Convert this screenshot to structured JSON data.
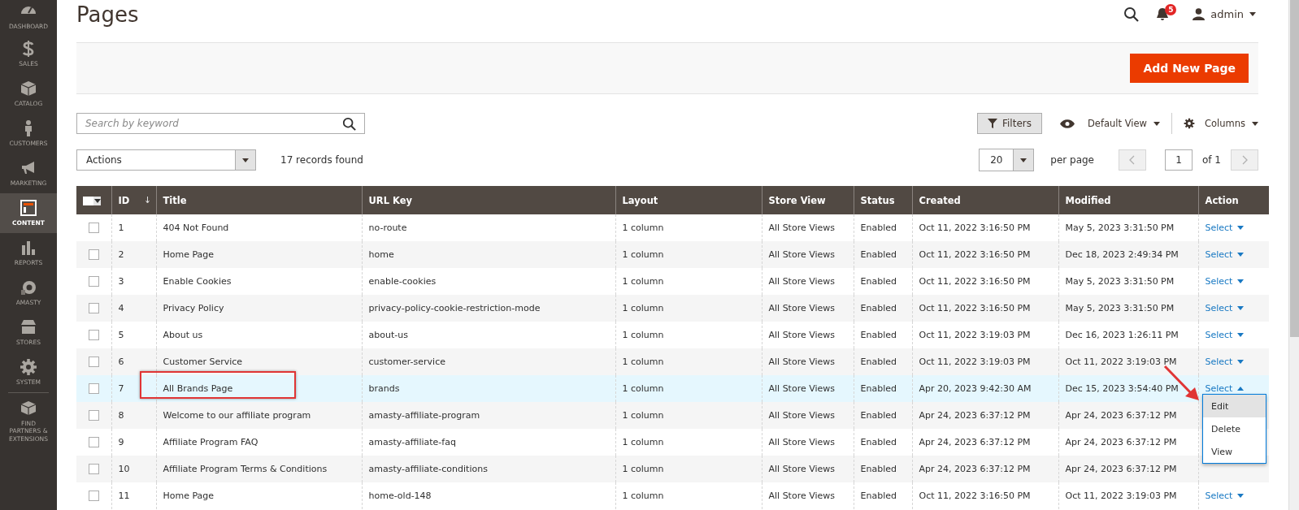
{
  "sidebar": {
    "items": [
      {
        "label": "DASHBOARD",
        "selected": false
      },
      {
        "label": "SALES",
        "selected": false
      },
      {
        "label": "CATALOG",
        "selected": false
      },
      {
        "label": "CUSTOMERS",
        "selected": false
      },
      {
        "label": "MARKETING",
        "selected": false
      },
      {
        "label": "CONTENT",
        "selected": true
      },
      {
        "label": "REPORTS",
        "selected": false
      },
      {
        "label": "AMASTY",
        "selected": false
      },
      {
        "label": "STORES",
        "selected": false
      },
      {
        "label": "SYSTEM",
        "selected": false
      },
      {
        "label": "FIND PARTNERS & EXTENSIONS",
        "selected": false
      }
    ]
  },
  "header": {
    "title": "Pages",
    "notifications": "5",
    "user": "admin"
  },
  "page_actions": {
    "button": "Add New Page"
  },
  "toolbar": {
    "search": {
      "placeholder": "Search by keyword"
    },
    "filters": "Filters",
    "view": "Default View",
    "columns": "Columns",
    "actions": "Actions",
    "records": "17 records found",
    "per_page_value": "20",
    "per_page": "per page",
    "page": "1",
    "of_pages": "of 1"
  },
  "table": {
    "select_all_checked": false,
    "columns": [
      "ID",
      "Title",
      "URL Key",
      "Layout",
      "Store View",
      "Status",
      "Created",
      "Modified",
      "Action"
    ],
    "rows": [
      {
        "id": "1",
        "title": "404 Not Found",
        "url_key": "no-route",
        "layout": "1 column",
        "store_view": "All Store Views",
        "status": "Enabled",
        "created": "Oct 11, 2022 3:16:50 PM",
        "modified": "May 5, 2023 3:31:50 PM",
        "action": "Select",
        "checked": false,
        "selected": false,
        "expanded": false
      },
      {
        "id": "2",
        "title": "Home Page",
        "url_key": "home",
        "layout": "1 column",
        "store_view": "All Store Views",
        "status": "Enabled",
        "created": "Oct 11, 2022 3:16:50 PM",
        "modified": "Dec 18, 2023 2:49:34 PM",
        "action": "Select",
        "checked": false,
        "selected": false,
        "expanded": false
      },
      {
        "id": "3",
        "title": "Enable Cookies",
        "url_key": "enable-cookies",
        "layout": "1 column",
        "store_view": "All Store Views",
        "status": "Enabled",
        "created": "Oct 11, 2022 3:16:50 PM",
        "modified": "May 5, 2023 3:31:50 PM",
        "action": "Select",
        "checked": false,
        "selected": false,
        "expanded": false
      },
      {
        "id": "4",
        "title": "Privacy Policy",
        "url_key": "privacy-policy-cookie-restriction-mode",
        "layout": "1 column",
        "store_view": "All Store Views",
        "status": "Enabled",
        "created": "Oct 11, 2022 3:16:50 PM",
        "modified": "May 5, 2023 3:31:50 PM",
        "action": "Select",
        "checked": false,
        "selected": false,
        "expanded": false
      },
      {
        "id": "5",
        "title": "About us",
        "url_key": "about-us",
        "layout": "1 column",
        "store_view": "All Store Views",
        "status": "Enabled",
        "created": "Oct 11, 2022 3:19:03 PM",
        "modified": "Dec 16, 2023 1:26:11 PM",
        "action": "Select",
        "checked": false,
        "selected": false,
        "expanded": false
      },
      {
        "id": "6",
        "title": "Customer Service",
        "url_key": "customer-service",
        "layout": "1 column",
        "store_view": "All Store Views",
        "status": "Enabled",
        "created": "Oct 11, 2022 3:19:03 PM",
        "modified": "Oct 11, 2022 3:19:03 PM",
        "action": "Select",
        "checked": false,
        "selected": false,
        "expanded": false
      },
      {
        "id": "7",
        "title": "All Brands Page",
        "url_key": "brands",
        "layout": "1 column",
        "store_view": "All Store Views",
        "status": "Enabled",
        "created": "Apr 20, 2023 9:42:30 AM",
        "modified": "Dec 15, 2023 3:54:40 PM",
        "action": "Select",
        "checked": false,
        "selected": true,
        "expanded": true,
        "menu": [
          {
            "label": "Edit",
            "selected": true
          },
          {
            "label": "Delete",
            "selected": false
          },
          {
            "label": "View",
            "selected": false
          }
        ]
      },
      {
        "id": "8",
        "title": "Welcome to our affiliate program",
        "url_key": "amasty-affiliate-program",
        "layout": "1 column",
        "store_view": "All Store Views",
        "status": "Enabled",
        "created": "Apr 24, 2023 6:37:12 PM",
        "modified": "Apr 24, 2023 6:37:12 PM",
        "checked": false,
        "selected": false
      },
      {
        "id": "9",
        "title": "Affiliate Program FAQ",
        "url_key": "amasty-affiliate-faq",
        "layout": "1 column",
        "store_view": "All Store Views",
        "status": "Enabled",
        "created": "Apr 24, 2023 6:37:12 PM",
        "modified": "Apr 24, 2023 6:37:12 PM",
        "checked": false,
        "selected": false
      },
      {
        "id": "10",
        "title": "Affiliate Program Terms & Conditions",
        "url_key": "amasty-affiliate-conditions",
        "layout": "1 column",
        "store_view": "All Store Views",
        "status": "Enabled",
        "created": "Apr 24, 2023 6:37:12 PM",
        "modified": "Apr 24, 2023 6:37:12 PM",
        "checked": false,
        "selected": false
      },
      {
        "id": "11",
        "title": "Home Page",
        "url_key": "home-old-148",
        "layout": "1 column",
        "store_view": "All Store Views",
        "status": "Enabled",
        "created": "Oct 11, 2022 3:16:50 PM",
        "modified": "Oct 11, 2022 3:19:03 PM",
        "action": "Select",
        "checked": false,
        "selected": false,
        "expanded": false
      }
    ]
  }
}
